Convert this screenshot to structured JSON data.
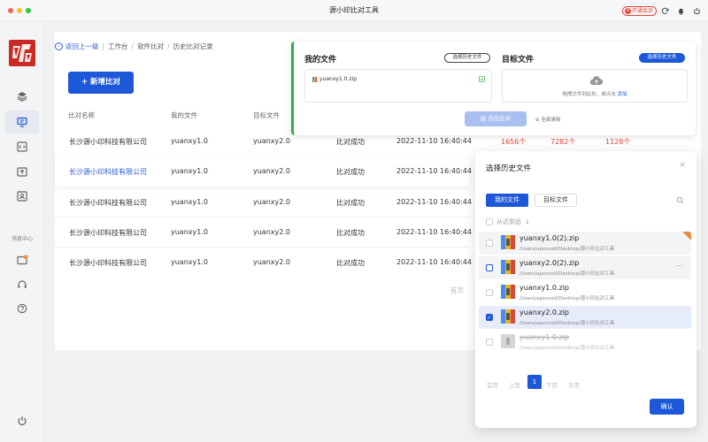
{
  "window": {
    "title": "源小印比对工具",
    "vip_label": "开通会员",
    "vip_glyph": "V"
  },
  "sidebar": {
    "section_label": "消息中心"
  },
  "breadcrumb": {
    "back": "返回上一级",
    "items": [
      "工作台",
      "软件比对",
      "历史比对记录"
    ],
    "separator": "/",
    "divider": "|"
  },
  "add_button": "+ 新增比对",
  "table": {
    "headers": [
      "比对名称",
      "我的文件",
      "目标文件"
    ],
    "rows": [
      {
        "name": "长沙源小印科技有限公司",
        "my": "yuanxy1.0",
        "target": "yuanxy2.0",
        "status": "比对成功",
        "time": "2022-11-10 16:40:44",
        "n1": "1656个",
        "n2": "7282个",
        "n3": "1128个"
      },
      {
        "name": "长沙源小印科技有限公司",
        "my": "yuanxy1.0",
        "target": "yuanxy2.0",
        "status": "比对成功",
        "time": "2022-11-10 16:40:44"
      },
      {
        "name": "长沙源小印科技有限公司",
        "my": "yuanxy1.0",
        "target": "yuanxy2.0",
        "status": "比对成功",
        "time": "2022-11-10 16:40:44"
      },
      {
        "name": "长沙源小印科技有限公司",
        "my": "yuanxy1.0",
        "target": "yuanxy2.0",
        "status": "比对成功",
        "time": "2022-11-10 16:40:44"
      },
      {
        "name": "长沙源小印科技有限公司",
        "my": "yuanxy1.0",
        "target": "yuanxy2.0",
        "status": "比对成功",
        "time": "2022-11-10 16:40:44"
      }
    ],
    "pager_first": "首页"
  },
  "upload": {
    "my_title": "我的文件",
    "target_title": "目标文件",
    "my_history_btn": "选择历史文件",
    "target_history_btn": "选择历史文件",
    "my_file": "yuanxy1.0.zip",
    "drop_text": "拖拽文件到此处，或点击",
    "drop_link": "添加",
    "compare_btn": "点击比对",
    "clear": "全部清除"
  },
  "modal": {
    "title": "选择历史文件",
    "close": "×",
    "tab_mine": "我的文件",
    "tab_target": "目标文件",
    "sort": "从近到远",
    "sort_arrow": "↓",
    "files": [
      {
        "name": "yuanxy1.0(2).zip",
        "path": "/Users/apencell/Desktop/源小印比对工具"
      },
      {
        "name": "yuanxy2.0(2).zip",
        "path": "/Users/apencell/Desktop/源小印比对工具"
      },
      {
        "name": "yuanxy1.0.zip",
        "path": "/Users/apencell/Desktop/源小印比对工具"
      },
      {
        "name": "yuanxy2.0.zip",
        "path": "/Users/apencell/Desktop/源小印比对工具"
      },
      {
        "name": "yuanxy1.0.zip",
        "path": "/Users/apencell/Desktop/源小印比对工具"
      }
    ],
    "more": "···",
    "check": "✓",
    "pager": {
      "first": "首页",
      "prev": "上页",
      "current": "1",
      "next": "下页",
      "last": "末页"
    },
    "confirm": "确认"
  },
  "colors": {
    "primary": "#1d58d8",
    "success": "#2ab04a",
    "danger": "#e5483b",
    "disabled": "#a9bff0"
  },
  "icons": [
    "close-dot",
    "minimize-dot",
    "zoom-dot",
    "refresh-icon",
    "bell-icon",
    "power-icon",
    "layers-icon",
    "monitor-icon",
    "code-icon",
    "upload-icon",
    "portrait-icon",
    "message-icon",
    "headset-icon",
    "help-icon",
    "cloud-upload-icon",
    "search-icon"
  ]
}
